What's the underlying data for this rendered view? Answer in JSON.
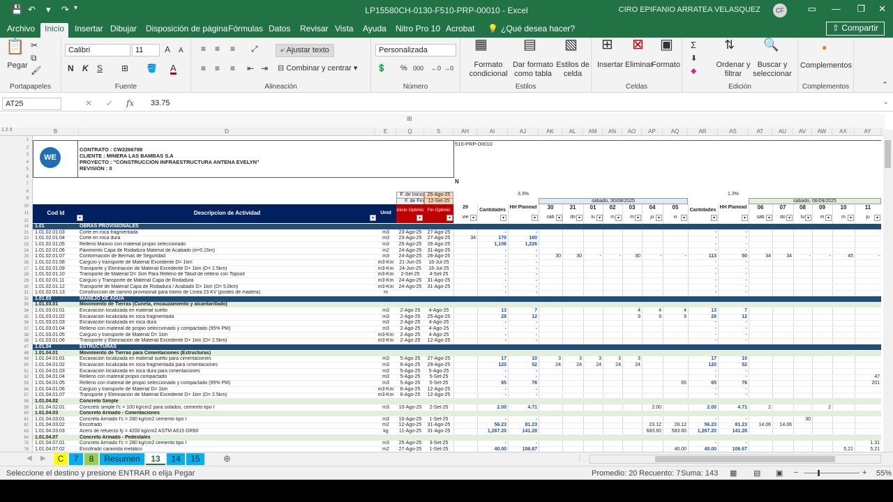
{
  "window": {
    "title": "LP15580CH-0130-F510-PRP-00010  -  Excel",
    "user": "CIRO EPIFANIO ARRATEA VELASQUEZ",
    "user_initials": "CF"
  },
  "menu": {
    "tabs": [
      "Archivo",
      "Inicio",
      "Insertar",
      "Dibujar",
      "Disposición de página",
      "Fórmulas",
      "Datos",
      "Revisar",
      "Vista",
      "Ayuda",
      "Nitro Pro 10",
      "Acrobat"
    ],
    "active": "Inicio",
    "tell_me": "¿Qué desea hacer?",
    "share": "Compartir"
  },
  "ribbon": {
    "clipboard": {
      "paste": "Pegar",
      "label": "Portapapeles"
    },
    "font": {
      "name": "Calibri",
      "size": "11",
      "bold": "N",
      "italic": "K",
      "underline": "S",
      "label": "Fuente"
    },
    "alignment": {
      "wrap": "Ajustar texto",
      "merge": "Combinar y centrar",
      "label": "Alineación"
    },
    "number": {
      "format": "Personalizada",
      "label": "Número"
    },
    "styles": {
      "cond": "Formato condicional",
      "table": "Dar formato como tabla",
      "cell": "Estilos de celda",
      "label": "Estilos"
    },
    "cells": {
      "insert": "Insertar",
      "delete": "Eliminar",
      "format": "Formato",
      "label": "Celdas"
    },
    "editing": {
      "sort": "Ordenar y filtrar",
      "find": "Buscar y seleccionar",
      "label": "Edición"
    },
    "addins": {
      "btn": "Complementos",
      "label": "Complementos"
    }
  },
  "formula_bar": {
    "name_box": "AT25",
    "value": "33.75"
  },
  "columns": [
    "B",
    "D",
    "E",
    "Q",
    "S",
    "AH",
    "AI",
    "AJ",
    "AK",
    "AL",
    "AM",
    "AN",
    "AO",
    "AP",
    "AQ",
    "AR",
    "AS",
    "AT",
    "AU",
    "AV",
    "AW",
    "AX",
    "AY"
  ],
  "header": {
    "contract": "CONTRATO    :  CW2266788",
    "client": "CLIENTE       :  MINERA LAS BAMBAS S.A",
    "project": "PROYECTO    :  \"CONSTRUCCIÓN INFRAESTRUCTURA ANTENA EVELYN\"",
    "revision": "REVISIÓN     :  0",
    "doc_code": "510-PRP-00010",
    "n": "N",
    "f_inicio": "F. de Inicio",
    "f_inicio_val": "25-Ago-25",
    "f_fin": "F. de Fin",
    "f_fin_val": "12-Set-25",
    "pct1": "3.3%",
    "pct2": "1.3%",
    "week1": "sábado, 30/08/2025",
    "week2": "sábado, 06/09/2025",
    "col_cod": "Cod Id",
    "col_desc": "Descripcion de Actividad",
    "col_unit": "Unid",
    "col_ini": "Inicio Optimis",
    "col_fin": "Fin Optimis",
    "col_cant": "Cantidades",
    "col_hh": "HH Planead",
    "day_29": "29",
    "day_vie": "vie",
    "days1": [
      "30",
      "31",
      "01",
      "02",
      "03",
      "04",
      "05"
    ],
    "dows1": [
      "sáb",
      "do",
      "lu",
      "m",
      "m",
      "ju",
      "vi"
    ],
    "days2": [
      "06",
      "07",
      "08",
      "09",
      "10",
      "11"
    ],
    "dows2": [
      "sáb",
      "do",
      "lu",
      "m",
      "m",
      "ju"
    ]
  },
  "rows": [
    {
      "n": "14",
      "type": "sec",
      "code": "1.01",
      "desc": "OBRAS PROVISIONALES"
    },
    {
      "n": "21",
      "code": "1.01.02.01.03",
      "desc": "Corte en roca fragmentada",
      "u": "m3",
      "i": "23-Ago-25",
      "f": "27-Ago-25",
      "c": "-",
      "h": "-"
    },
    {
      "n": "22",
      "code": "1.01.02.01.04",
      "desc": "Corte en roca dura",
      "u": "m3",
      "i": "23-Ago-25",
      "f": "27-Ago-25",
      "ah": "34",
      "c": "170",
      "h": "160"
    },
    {
      "n": "23",
      "code": "1.01.02.01.05",
      "desc": "Relleno Masivo con material propio seleccionado",
      "u": "m3",
      "i": "25-Ago-25",
      "f": "26-Ago-25",
      "c": "1,106",
      "h": "1,226"
    },
    {
      "n": "24",
      "code": "1.01.02.01.06",
      "desc": "Pavimento Capa de Rodadura Material de Acabado (e=0.15m)",
      "u": "m2",
      "i": "24-Ago-25",
      "f": "31-Ago-25",
      "c": "-",
      "h": "-"
    },
    {
      "n": "25",
      "code": "1.01.02.01.07",
      "desc": "Conformación de Bermas de Seguridad",
      "u": "m3",
      "i": "24-Ago-25",
      "f": "28-Ago-25",
      "c": "-",
      "h": "-",
      "d": [
        "30",
        "30",
        "-",
        "-",
        "30",
        "-",
        "-"
      ],
      "c2": "113",
      "h2": "50",
      "e": [
        "34",
        "34",
        "-",
        "-",
        "45",
        "-"
      ]
    },
    {
      "n": "26",
      "code": "1.01.02.01.08",
      "desc": "Carguío y transporte de Material Excedente D= 1km",
      "u": "m3-Km",
      "i": "21-Jun-25",
      "f": "16-Jul-25",
      "c": "-",
      "h": "-"
    },
    {
      "n": "27",
      "code": "1.01.02.01.09",
      "desc": "Transporte y Eliminación de Material Excedente D> 1km (D= 2.5km)",
      "u": "m3-Km",
      "i": "24-Jun-25",
      "f": "16-Jul-25",
      "c": "-",
      "h": "-"
    },
    {
      "n": "28",
      "code": "1.01.02.01.10",
      "desc": "Transporte de Material D= 1km Para Relleno de Talud de relleno con Topsoil",
      "u": "m3-Km",
      "i": "2-Set-25",
      "f": "4-Set-25",
      "c": "-",
      "h": "-"
    },
    {
      "n": "29",
      "code": "1.01.02.01.11",
      "desc": "Carguío y Transporte de Material Capa de Rodadura",
      "u": "m3-Km",
      "i": "24-Ago-25",
      "f": "31-Ago-25",
      "c": "-",
      "h": "-"
    },
    {
      "n": "30",
      "code": "1.01.02.01.12",
      "desc": "Transporte de Material Capa de Rodadura / Acabado D> 1km (D= 5.0km)",
      "u": "m3-Km",
      "i": "24-Ago-25",
      "f": "31-Ago-25",
      "c": "-",
      "h": "-"
    },
    {
      "n": "31",
      "code": "1.01.02.01.13",
      "desc": "Construcción de camino provisional para tramo de Línea 23 KV (postes de madera)",
      "u": "m",
      "c": "-",
      "h": "-"
    },
    {
      "n": "32",
      "type": "sec",
      "code": "1.01.03",
      "desc": "MANEJO DE AGUA"
    },
    {
      "n": "33",
      "type": "sub",
      "code": "1.01.03.01",
      "desc": "Movimiento de Tierras (Cuneta, encauzamiento y alcantarillado)"
    },
    {
      "n": "34",
      "code": "1.01.03.01.01",
      "desc": "Excavación localizada en material suelto",
      "u": "m3",
      "i": "2-Ago-25",
      "f": "4-Ago-25",
      "c": "13",
      "h": "7",
      "d": [
        "",
        "",
        "",
        "",
        "",
        "4",
        "4"
      ],
      "dx": "4"
    },
    {
      "n": "35",
      "code": "1.01.03.01.02",
      "desc": "Excavación localizada en roca fragmentada",
      "u": "m3",
      "i": "2-Ago-25",
      "f": "25-Ago-25",
      "c": "28",
      "h": "12",
      "d": [
        "",
        "",
        "",
        "",
        "",
        "9",
        "9"
      ],
      "dx": "9"
    },
    {
      "n": "36",
      "code": "1.01.03.01.03",
      "desc": "Excavación localizada en roca dura",
      "u": "m3",
      "i": "2-Ago-25",
      "f": "4-Ago-25",
      "c": "-",
      "h": "-"
    },
    {
      "n": "37",
      "code": "1.01.03.01.04",
      "desc": "Relleno con material de propio seleccionado y compactado (95% PM)",
      "u": "m3",
      "i": "2-Ago-25",
      "f": "4-Ago-25",
      "c": "-",
      "h": "-"
    },
    {
      "n": "38",
      "code": "1.01.03.01.05",
      "desc": "Carguío y transporte de Material D= 1km",
      "u": "m3-Km",
      "i": "2-Ago-25",
      "f": "4-Ago-25",
      "c": "-",
      "h": "-"
    },
    {
      "n": "39",
      "code": "1.01.03.01.06",
      "desc": "Transporte y Eliminación de Material Excedente D> 1km (D= 2.5km)",
      "u": "m3-Km",
      "i": "2-Ago-25",
      "f": "12-Ago-25",
      "c": "-",
      "h": "-"
    },
    {
      "n": "47",
      "type": "sec",
      "code": "1.01.04",
      "desc": "ESTRUCTURAS"
    },
    {
      "n": "48",
      "type": "sub",
      "code": "1.01.04.01",
      "desc": "Movimiento de Tierras para Cimentaciones (Estructuras)"
    },
    {
      "n": "49",
      "code": "1.01.04.01.01",
      "desc": "Excavación localizada en material suelto para cimentaciones",
      "u": "m3",
      "i": "5-Ago-25",
      "f": "27-Ago-25",
      "c": "17",
      "h": "10",
      "d": [
        "3",
        "3",
        "3",
        "3",
        "3",
        "",
        ""
      ]
    },
    {
      "n": "50",
      "code": "1.01.04.01.02",
      "desc": "Excavación localizada en roca fragmentada para cimentaciones",
      "u": "m3",
      "i": "6-Ago-25",
      "f": "29-Ago-25",
      "c": "120",
      "h": "52",
      "d": [
        "24",
        "24",
        "24",
        "24",
        "24",
        "",
        ""
      ]
    },
    {
      "n": "51",
      "code": "1.01.04.01.03",
      "desc": "Excavación localizada en roca dura para cimentaciones",
      "u": "m3",
      "i": "5-Ago-25",
      "f": "5-Ago-25",
      "c": "-",
      "h": "-"
    },
    {
      "n": "52",
      "code": "1.01.04.01.04",
      "desc": "Relleno con material propio compactado",
      "u": "m3",
      "i": "5-Ago-25",
      "f": "5-Set-25",
      "c": "-",
      "h": "-",
      "ex": "47"
    },
    {
      "n": "53",
      "code": "1.01.04.01.05",
      "desc": "Relleno con material de propio seleccionado y compactado (95% PM)",
      "u": "m3",
      "i": "5-Ago-25",
      "f": "5-Set-25",
      "c": "65",
      "h": "76",
      "d": [
        "",
        "",
        "",
        "",
        "",
        "",
        "65"
      ],
      "ex": "201"
    },
    {
      "n": "54",
      "code": "1.01.04.01.06",
      "desc": "Carguío y transporte de Material D= 1km",
      "u": "m3-Km",
      "i": "6-Ago-25",
      "f": "12-Ago-25",
      "c": "-",
      "h": "-"
    },
    {
      "n": "57",
      "code": "1.01.04.01.07",
      "desc": "Transporte y Eliminación de Material Excedente D> 1km (D= 2.5km)",
      "u": "m3-Km",
      "i": "6-Ago-25",
      "f": "12-Ago-25",
      "c": "-",
      "h": "-"
    },
    {
      "n": "58",
      "type": "sub",
      "code": "1.01.04.02",
      "desc": "Concreto Simple"
    },
    {
      "n": "59",
      "code": "1.01.04.02.01",
      "desc": "Concreto simple f'c = 100 kg/cm2 para solados, cemento tipo I",
      "u": "m3",
      "i": "10-Ago-25",
      "f": "2-Set-25",
      "c": "2.00",
      "h": "4.71",
      "d": [
        "",
        "",
        "",
        "",
        "",
        "2.00",
        ""
      ],
      "e": [
        "2",
        "",
        "",
        "2",
        "",
        ""
      ]
    },
    {
      "n": "60",
      "type": "sub",
      "code": "1.01.04.03",
      "desc": "Concreto Armado - Cimentaciones"
    },
    {
      "n": "61",
      "code": "1.01.04.03.01",
      "desc": "Concreto Armado f'c = 280 kg/cm2 cemento tipo I",
      "u": "m3",
      "i": "10-Ago-25",
      "f": "1-Set-25",
      "c": "-",
      "h": "-",
      "e": [
        "",
        "",
        "30",
        "",
        "",
        ""
      ]
    },
    {
      "n": "62",
      "code": "1.01.04.03.02",
      "desc": "Encofrado",
      "u": "m2",
      "i": "12-Ago-25",
      "f": "31-Ago-25",
      "c": "56.23",
      "h": "81.23",
      "d": [
        "",
        "",
        "",
        "",
        "",
        "23.12",
        "28.12"
      ],
      "e": [
        "14.06",
        "14.06",
        "",
        "",
        "",
        ""
      ]
    },
    {
      "n": "63",
      "code": "1.01.04.03.03",
      "desc": "Acero de refuerzo fy = 4200 kg/cm2 ASTM A615 GR60",
      "u": "kg",
      "i": "11-Ago-25",
      "f": "31-Ago-25",
      "c": "1,267.20",
      "h": "141.28",
      "d": [
        "",
        "",
        "",
        "",
        "",
        "683.60",
        "583.60"
      ]
    },
    {
      "n": "64",
      "type": "sub",
      "code": "1.01.04.07",
      "desc": "Concreto Armado - Pedestales"
    },
    {
      "n": "75",
      "code": "1.01.04.07.01",
      "desc": "Concreto Armado f'c = 280 kg/cm2 cemento tipo I",
      "u": "m3",
      "i": "25-Ago-25",
      "f": "3-Set-25",
      "c": "-",
      "h": "-",
      "ex": "1.31"
    },
    {
      "n": "76",
      "code": "1.01.04.07.02",
      "desc": "Encofrado caravista metálico",
      "u": "m2",
      "i": "27-Ago-25",
      "f": "1-Set-25",
      "c": "40.00",
      "h": "106.67",
      "d": [
        "",
        "",
        "",
        "",
        "",
        "",
        "40.00"
      ],
      "e": [
        "",
        "",
        "",
        "",
        "5.21",
        "5.21"
      ]
    }
  ],
  "sheet_tabs": [
    "C",
    "7",
    "8",
    "Resumen",
    "13",
    "14",
    "15"
  ],
  "active_sheet": "13",
  "status": {
    "message": "Seleccione el destino y presione ENTRAR o elija Pegar",
    "average": "Promedio: 20",
    "count": "Recuento: 7",
    "sum": "Suma: 143",
    "zoom": "55%"
  },
  "colors": {
    "excel_green": "#217346",
    "header_navy": "#002060",
    "section_blue": "#1f4e79",
    "sub_green": "#e2efda",
    "red_hdr": "#c00000"
  }
}
